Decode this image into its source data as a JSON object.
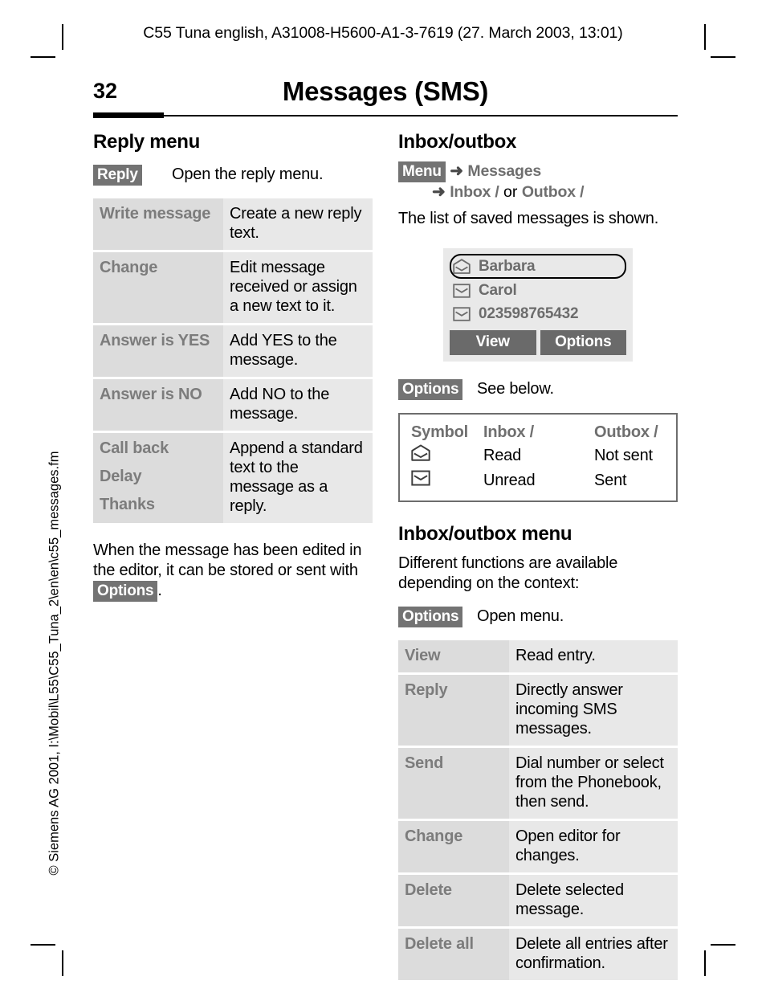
{
  "document": {
    "running_header": "C55 Tuna english, A31008-H5600-A1-3-7619 (27. March 2003, 13:01)",
    "page_number": "32",
    "chapter_title": "Messages (SMS)",
    "side_footer": "© Siemens AG 2001, I:\\Mobil\\L55\\C55_Tuna_2\\en\\en\\c55_messages.fm"
  },
  "left_column": {
    "heading": "Reply menu",
    "reply_key": {
      "key_label": "Reply",
      "description": "Open the reply menu."
    },
    "reply_menu_table": [
      {
        "term": "Write message",
        "term_sub": "",
        "term_sub2": "",
        "desc": "Create a new reply text."
      },
      {
        "term": "Change",
        "term_sub": "",
        "term_sub2": "",
        "desc": "Edit message received or assign a new text to it."
      },
      {
        "term": "Answer is YES",
        "term_sub": "",
        "term_sub2": "",
        "desc": "Add YES to the message."
      },
      {
        "term": "Answer is NO",
        "term_sub": "",
        "term_sub2": "",
        "desc": "Add NO to the message."
      },
      {
        "term": "Call back",
        "term_sub": "Delay",
        "term_sub2": "Thanks",
        "desc": "Append a standard text to the message as a reply."
      }
    ],
    "closing_paragraph": {
      "part1": "When the message has been edited in the editor, it can be stored or sent with ",
      "key_label": "Options",
      "part2": "."
    }
  },
  "right_column": {
    "heading": "Inbox/outbox",
    "nav_path": {
      "key_label": "Menu",
      "arrow": "➜",
      "item1": "Messages",
      "item2": "Inbox /",
      "connector": "or",
      "item3": "Outbox /"
    },
    "intro": "The list of saved messages is shown.",
    "phone_screen": {
      "rows": [
        {
          "icon": "envelope-open-icon",
          "label": "Barbara",
          "selected": true
        },
        {
          "icon": "envelope-closed-icon",
          "label": "Carol",
          "selected": false
        },
        {
          "icon": "envelope-closed-icon",
          "label": "023598765432",
          "selected": false
        }
      ],
      "softkeys": [
        "View",
        "Options"
      ]
    },
    "options_key": {
      "key_label": "Options",
      "description": "See below."
    },
    "symbol_table": {
      "headers": [
        "Symbol",
        "Inbox /",
        "Outbox /"
      ],
      "rows": [
        {
          "icon": "envelope-open-icon",
          "inbox": "Read",
          "outbox": "Not sent"
        },
        {
          "icon": "envelope-closed-icon",
          "inbox": "Unread",
          "outbox": "Sent"
        }
      ]
    },
    "menu_section": {
      "heading": "Inbox/outbox menu",
      "intro": "Different functions are available depending on the context:",
      "options_key": {
        "key_label": "Options",
        "description": "Open menu."
      },
      "table": [
        {
          "term": "View",
          "desc": "Read entry."
        },
        {
          "term": "Reply",
          "desc": "Directly answer incoming SMS messages."
        },
        {
          "term": "Send",
          "desc": "Dial number or select from the Phonebook, then send."
        },
        {
          "term": "Change",
          "desc": "Open editor for changes."
        },
        {
          "term": "Delete",
          "desc": "Delete selected message."
        },
        {
          "term": "Delete all",
          "desc": "Delete all entries after confirmation."
        }
      ]
    }
  },
  "colors": {
    "softkey_bg": "#737373",
    "table_term_bg": "#dcdcdc",
    "table_desc_bg": "#e8e8e8",
    "term_text": "#7c7c7c",
    "phone_bg": "#e9e9e9",
    "phone_button_bg": "#6a6a6a"
  }
}
